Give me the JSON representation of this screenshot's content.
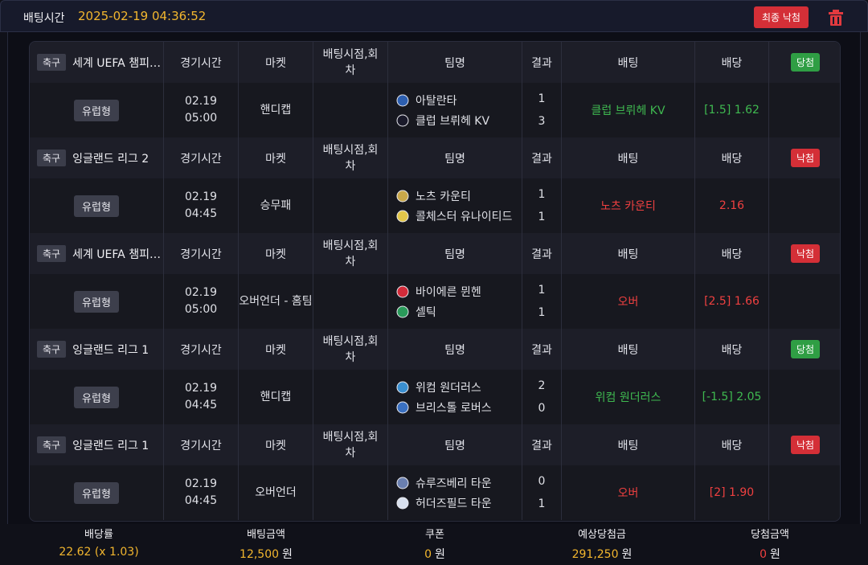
{
  "header": {
    "label": "배팅시간",
    "timestamp": "2025-02-19 04:36:52",
    "final_button": "최종 낙첨",
    "trash_icon": "trash-icon",
    "colors": {
      "accent": "#f2b62e",
      "danger": "#d42f37",
      "win": "#2f9e44"
    }
  },
  "columns": {
    "time": "경기시간",
    "market": "마켓",
    "bet_point": "배팅시점,회차",
    "team": "팀명",
    "result": "결과",
    "bet": "배팅",
    "odds": "배당"
  },
  "bets": [
    {
      "sport": "축구",
      "league": "세계 UEFA 챔피언스리그",
      "status": "당첨",
      "status_kind": "win",
      "type": "유럽형",
      "date": "02.19",
      "time": "05:00",
      "market": "핸디캡",
      "team1": "아탈란타",
      "team2": "클럽 브뤼헤 KV",
      "score1": "1",
      "score2": "3",
      "pick": "클럽 브뤼헤 KV",
      "odds": "[1.5] 1.62",
      "icon1": "atalanta-logo-icon",
      "icon2": "club-brugge-logo-icon"
    },
    {
      "sport": "축구",
      "league": "잉글랜드 리그 2",
      "status": "낙첨",
      "status_kind": "lose",
      "type": "유럽형",
      "date": "02.19",
      "time": "04:45",
      "market": "승무패",
      "team1": "노츠 카운티",
      "team2": "콜체스터 유나이티드",
      "score1": "1",
      "score2": "1",
      "pick": "노츠 카운티",
      "odds": "2.16",
      "icon1": "notts-county-logo-icon",
      "icon2": "colchester-logo-icon"
    },
    {
      "sport": "축구",
      "league": "세계 UEFA 챔피언스리그",
      "status": "낙첨",
      "status_kind": "lose",
      "type": "유럽형",
      "date": "02.19",
      "time": "05:00",
      "market": "오버언더 - 홈팀",
      "team1": "바이에른 뮌헨",
      "team2": "셀틱",
      "score1": "1",
      "score2": "1",
      "pick": "오버",
      "odds": "[2.5] 1.66",
      "icon1": "bayern-logo-icon",
      "icon2": "celtic-logo-icon"
    },
    {
      "sport": "축구",
      "league": "잉글랜드 리그 1",
      "status": "당첨",
      "status_kind": "win",
      "type": "유럽형",
      "date": "02.19",
      "time": "04:45",
      "market": "핸디캡",
      "team1": "위컴 원더러스",
      "team2": "브리스톨 로버스",
      "score1": "2",
      "score2": "0",
      "pick": "위컴 원더러스",
      "odds": "[-1.5] 2.05",
      "icon1": "wycombe-logo-icon",
      "icon2": "bristol-rovers-logo-icon"
    },
    {
      "sport": "축구",
      "league": "잉글랜드 리그 1",
      "status": "낙첨",
      "status_kind": "lose",
      "type": "유럽형",
      "date": "02.19",
      "time": "04:45",
      "market": "오버언더",
      "team1": "슈루즈베리 타운",
      "team2": "허더즈필드 타운",
      "score1": "0",
      "score2": "1",
      "pick": "오버",
      "odds": "[2] 1.90",
      "icon1": "shrewsbury-logo-icon",
      "icon2": "huddersfield-logo-icon"
    }
  ],
  "summary": {
    "odds_label": "배당률",
    "odds_value": "22.62 (x 1.03)",
    "bet_amount_label": "배팅금액",
    "bet_amount_value": "12,500",
    "coupon_label": "쿠폰",
    "coupon_value": "0",
    "expected_label": "예상당첨금",
    "expected_value": "291,250",
    "win_label": "당첨금액",
    "win_value": "0",
    "unit": "원"
  }
}
